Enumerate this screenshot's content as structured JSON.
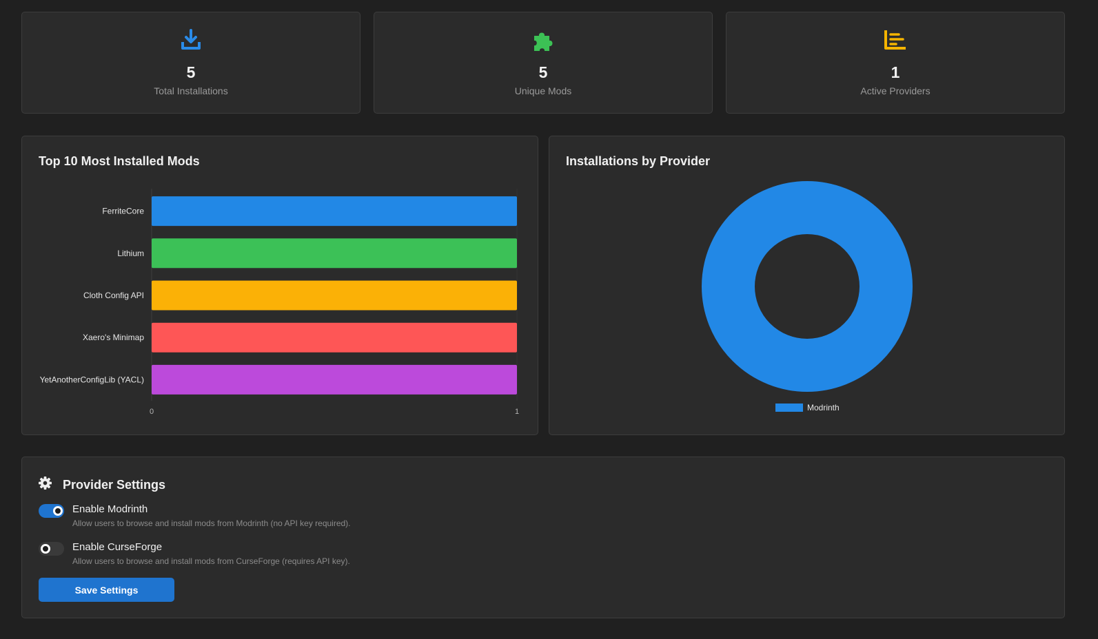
{
  "colors": {
    "accent": "#1f74cf",
    "download_icon": "#2a8be8",
    "puzzle_icon": "#3cc155",
    "chart_icon": "#f5b400"
  },
  "stats": [
    {
      "icon": "download-icon",
      "value": "5",
      "label": "Total Installations"
    },
    {
      "icon": "puzzle-icon",
      "value": "5",
      "label": "Unique Mods"
    },
    {
      "icon": "list-chart-icon",
      "value": "1",
      "label": "Active Providers"
    }
  ],
  "top_mods": {
    "title": "Top 10 Most Installed Mods"
  },
  "providers_chart": {
    "title": "Installations by Provider"
  },
  "chart_data": [
    {
      "type": "bar",
      "orientation": "horizontal",
      "categories": [
        "FerriteCore",
        "Lithium",
        "Cloth Config API",
        "Xaero's Minimap",
        "YetAnotherConfigLib (YACL)"
      ],
      "values": [
        1,
        1,
        1,
        1,
        1
      ],
      "colors": [
        "#2288e6",
        "#3cc157",
        "#fbb106",
        "#fe5656",
        "#bc4adb"
      ],
      "xlim": [
        0,
        1
      ],
      "xticks": [
        "0",
        "1"
      ],
      "title": "Top 10 Most Installed Mods",
      "grid": false
    },
    {
      "type": "pie",
      "variant": "doughnut",
      "labels": [
        "Modrinth"
      ],
      "values": [
        5
      ],
      "colors": [
        "#2288e6"
      ],
      "legend": "bottom",
      "title": "Installations by Provider"
    }
  ],
  "settings": {
    "title": "Provider Settings",
    "icon": "gear-icon",
    "modrinth": {
      "label": "Enable Modrinth",
      "description": "Allow users to browse and install mods from Modrinth (no API key required).",
      "enabled": true
    },
    "curseforge": {
      "label": "Enable CurseForge",
      "description": "Allow users to browse and install mods from CurseForge (requires API key).",
      "enabled": false
    },
    "save_label": "Save Settings"
  }
}
